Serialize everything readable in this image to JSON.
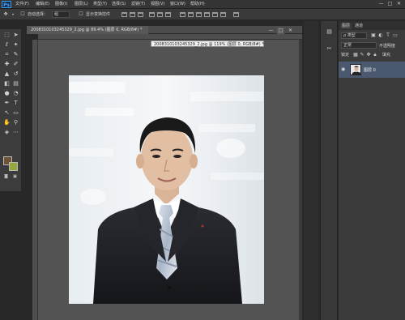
{
  "app": {
    "logo": "Ps",
    "menu": [
      "文件(F)",
      "编辑(E)",
      "图像(I)",
      "图层(L)",
      "类型(Y)",
      "选择(S)",
      "滤镜(T)",
      "视图(V)",
      "窗口(W)",
      "帮助(H)"
    ],
    "window_controls": [
      "—",
      "□",
      "✕"
    ]
  },
  "options": {
    "auto_select_label": "自动选择：",
    "auto_select_value": "组",
    "show_transform_label": "显示变换控件"
  },
  "document": {
    "tab_title": "20083101032453​29_2.jpg @ 89.4% (图层 0, RGB/8#) *",
    "tooltip": "2008310103245329_2.jpg @ 119% (图层 0, RGB/8#) *",
    "doc_controls": [
      "—",
      "□",
      "✕"
    ]
  },
  "layers": {
    "tabs": [
      "图层",
      "通道"
    ],
    "filter_label": "ρ 类型",
    "blend_mode": "正常",
    "opacity_label": "不透明度",
    "lock_label": "锁定",
    "fill_label": "填充",
    "layer_name": "图层 0"
  },
  "colors": {
    "foreground": "#6e5236",
    "background": "#97a63a",
    "accent": "#31a8ff",
    "selected_layer": "#4a5970"
  }
}
